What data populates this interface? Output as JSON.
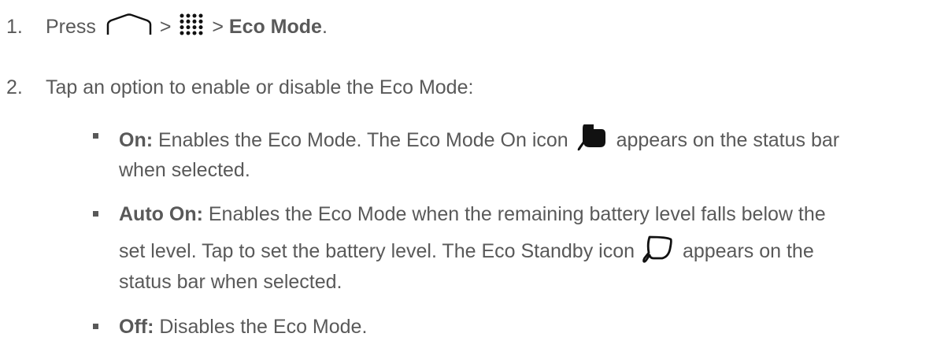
{
  "steps": [
    {
      "number": "1.",
      "text_before": "Press",
      "sep1": ">",
      "sep2": ">",
      "bold": "Eco Mode",
      "text_after": ".",
      "icons": [
        "home-icon",
        "apps-grid-icon"
      ]
    },
    {
      "number": "2.",
      "text": "Tap an option to enable or disable the Eco Mode:"
    }
  ],
  "options": [
    {
      "label": "On:",
      "line1_before": "Enables the Eco Mode. The Eco Mode On icon",
      "line1_after": "appears on the status bar",
      "line2": "when selected.",
      "icon": "eco-mode-on-icon"
    },
    {
      "label": "Auto On:",
      "line1": "Enables the Eco Mode when the remaining battery level falls below the",
      "line2_before": "set level. Tap to set the battery level. The Eco Standby icon",
      "line2_after": "appears on the",
      "line3": "status bar when selected.",
      "icon": "eco-standby-icon"
    },
    {
      "label": "Off:",
      "text": "Disables the Eco Mode."
    }
  ],
  "colors": {
    "text": "#595959",
    "icon": "#111111"
  }
}
